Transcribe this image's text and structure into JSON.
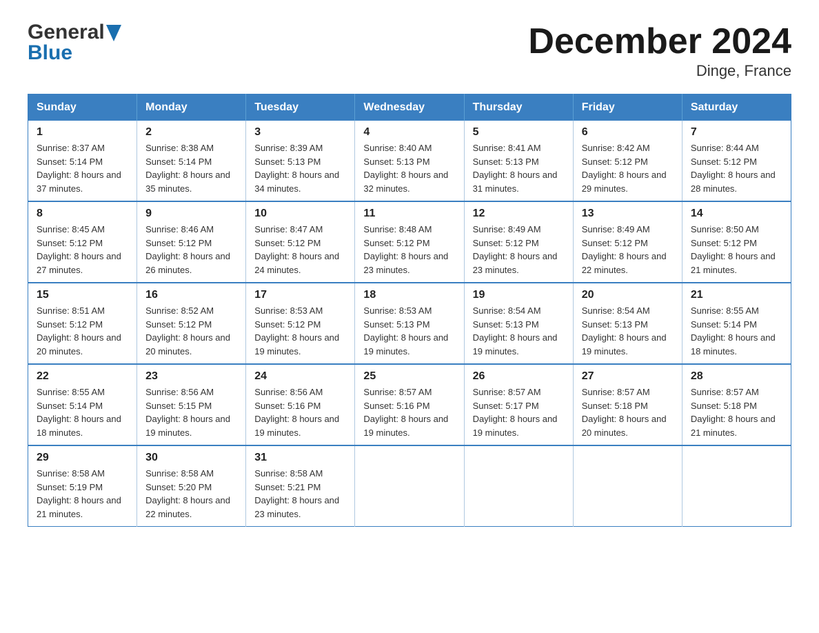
{
  "header": {
    "logo_general": "General",
    "logo_blue": "Blue",
    "title": "December 2024",
    "subtitle": "Dinge, France"
  },
  "days_header": [
    "Sunday",
    "Monday",
    "Tuesday",
    "Wednesday",
    "Thursday",
    "Friday",
    "Saturday"
  ],
  "weeks": [
    [
      {
        "day": "1",
        "sunrise": "8:37 AM",
        "sunset": "5:14 PM",
        "daylight": "8 hours and 37 minutes."
      },
      {
        "day": "2",
        "sunrise": "8:38 AM",
        "sunset": "5:14 PM",
        "daylight": "8 hours and 35 minutes."
      },
      {
        "day": "3",
        "sunrise": "8:39 AM",
        "sunset": "5:13 PM",
        "daylight": "8 hours and 34 minutes."
      },
      {
        "day": "4",
        "sunrise": "8:40 AM",
        "sunset": "5:13 PM",
        "daylight": "8 hours and 32 minutes."
      },
      {
        "day": "5",
        "sunrise": "8:41 AM",
        "sunset": "5:13 PM",
        "daylight": "8 hours and 31 minutes."
      },
      {
        "day": "6",
        "sunrise": "8:42 AM",
        "sunset": "5:12 PM",
        "daylight": "8 hours and 29 minutes."
      },
      {
        "day": "7",
        "sunrise": "8:44 AM",
        "sunset": "5:12 PM",
        "daylight": "8 hours and 28 minutes."
      }
    ],
    [
      {
        "day": "8",
        "sunrise": "8:45 AM",
        "sunset": "5:12 PM",
        "daylight": "8 hours and 27 minutes."
      },
      {
        "day": "9",
        "sunrise": "8:46 AM",
        "sunset": "5:12 PM",
        "daylight": "8 hours and 26 minutes."
      },
      {
        "day": "10",
        "sunrise": "8:47 AM",
        "sunset": "5:12 PM",
        "daylight": "8 hours and 24 minutes."
      },
      {
        "day": "11",
        "sunrise": "8:48 AM",
        "sunset": "5:12 PM",
        "daylight": "8 hours and 23 minutes."
      },
      {
        "day": "12",
        "sunrise": "8:49 AM",
        "sunset": "5:12 PM",
        "daylight": "8 hours and 23 minutes."
      },
      {
        "day": "13",
        "sunrise": "8:49 AM",
        "sunset": "5:12 PM",
        "daylight": "8 hours and 22 minutes."
      },
      {
        "day": "14",
        "sunrise": "8:50 AM",
        "sunset": "5:12 PM",
        "daylight": "8 hours and 21 minutes."
      }
    ],
    [
      {
        "day": "15",
        "sunrise": "8:51 AM",
        "sunset": "5:12 PM",
        "daylight": "8 hours and 20 minutes."
      },
      {
        "day": "16",
        "sunrise": "8:52 AM",
        "sunset": "5:12 PM",
        "daylight": "8 hours and 20 minutes."
      },
      {
        "day": "17",
        "sunrise": "8:53 AM",
        "sunset": "5:12 PM",
        "daylight": "8 hours and 19 minutes."
      },
      {
        "day": "18",
        "sunrise": "8:53 AM",
        "sunset": "5:13 PM",
        "daylight": "8 hours and 19 minutes."
      },
      {
        "day": "19",
        "sunrise": "8:54 AM",
        "sunset": "5:13 PM",
        "daylight": "8 hours and 19 minutes."
      },
      {
        "day": "20",
        "sunrise": "8:54 AM",
        "sunset": "5:13 PM",
        "daylight": "8 hours and 19 minutes."
      },
      {
        "day": "21",
        "sunrise": "8:55 AM",
        "sunset": "5:14 PM",
        "daylight": "8 hours and 18 minutes."
      }
    ],
    [
      {
        "day": "22",
        "sunrise": "8:55 AM",
        "sunset": "5:14 PM",
        "daylight": "8 hours and 18 minutes."
      },
      {
        "day": "23",
        "sunrise": "8:56 AM",
        "sunset": "5:15 PM",
        "daylight": "8 hours and 19 minutes."
      },
      {
        "day": "24",
        "sunrise": "8:56 AM",
        "sunset": "5:16 PM",
        "daylight": "8 hours and 19 minutes."
      },
      {
        "day": "25",
        "sunrise": "8:57 AM",
        "sunset": "5:16 PM",
        "daylight": "8 hours and 19 minutes."
      },
      {
        "day": "26",
        "sunrise": "8:57 AM",
        "sunset": "5:17 PM",
        "daylight": "8 hours and 19 minutes."
      },
      {
        "day": "27",
        "sunrise": "8:57 AM",
        "sunset": "5:18 PM",
        "daylight": "8 hours and 20 minutes."
      },
      {
        "day": "28",
        "sunrise": "8:57 AM",
        "sunset": "5:18 PM",
        "daylight": "8 hours and 21 minutes."
      }
    ],
    [
      {
        "day": "29",
        "sunrise": "8:58 AM",
        "sunset": "5:19 PM",
        "daylight": "8 hours and 21 minutes."
      },
      {
        "day": "30",
        "sunrise": "8:58 AM",
        "sunset": "5:20 PM",
        "daylight": "8 hours and 22 minutes."
      },
      {
        "day": "31",
        "sunrise": "8:58 AM",
        "sunset": "5:21 PM",
        "daylight": "8 hours and 23 minutes."
      },
      null,
      null,
      null,
      null
    ]
  ],
  "labels": {
    "sunrise": "Sunrise:",
    "sunset": "Sunset:",
    "daylight": "Daylight:"
  }
}
